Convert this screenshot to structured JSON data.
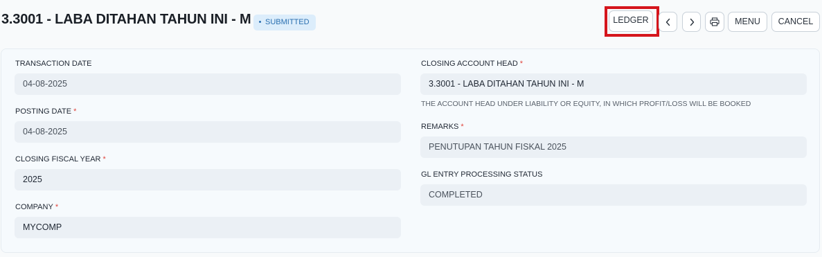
{
  "header": {
    "title": "3.3001 - LABA DITAHAN TAHUN INI - M",
    "status": "SUBMITTED",
    "buttons": {
      "ledger": "LEDGER",
      "menu": "MENU",
      "cancel": "CANCEL"
    },
    "icons": [
      "chevron-left-icon",
      "chevron-right-icon",
      "printer-icon"
    ]
  },
  "form": {
    "transaction_date": {
      "label": "TRANSACTION DATE",
      "value": "04-08-2025"
    },
    "posting_date": {
      "label": "POSTING DATE",
      "value": "04-08-2025",
      "required": "*"
    },
    "closing_fiscal_year": {
      "label": "CLOSING FISCAL YEAR",
      "value": "2025",
      "required": "*"
    },
    "company": {
      "label": "COMPANY",
      "value": "MYCOMP",
      "required": "*"
    },
    "closing_account_head": {
      "label": "CLOSING ACCOUNT HEAD",
      "value": "3.3001 - LABA DITAHAN TAHUN INI - M",
      "required": "*",
      "help": "THE ACCOUNT HEAD UNDER LIABILITY OR EQUITY, IN WHICH PROFIT/LOSS WILL BE BOOKED"
    },
    "remarks": {
      "label": "REMARKS",
      "value": "PENUTUPAN TAHUN FISKAL 2025",
      "required": "*"
    },
    "gl_entry_processing_status": {
      "label": "GL ENTRY PROCESSING STATUS",
      "value": "COMPLETED"
    }
  },
  "colors": {
    "accent_highlight": "#d5151c",
    "badge_bg": "#dcedfb",
    "badge_text": "#2a6fb0",
    "required": "#e0443c"
  }
}
